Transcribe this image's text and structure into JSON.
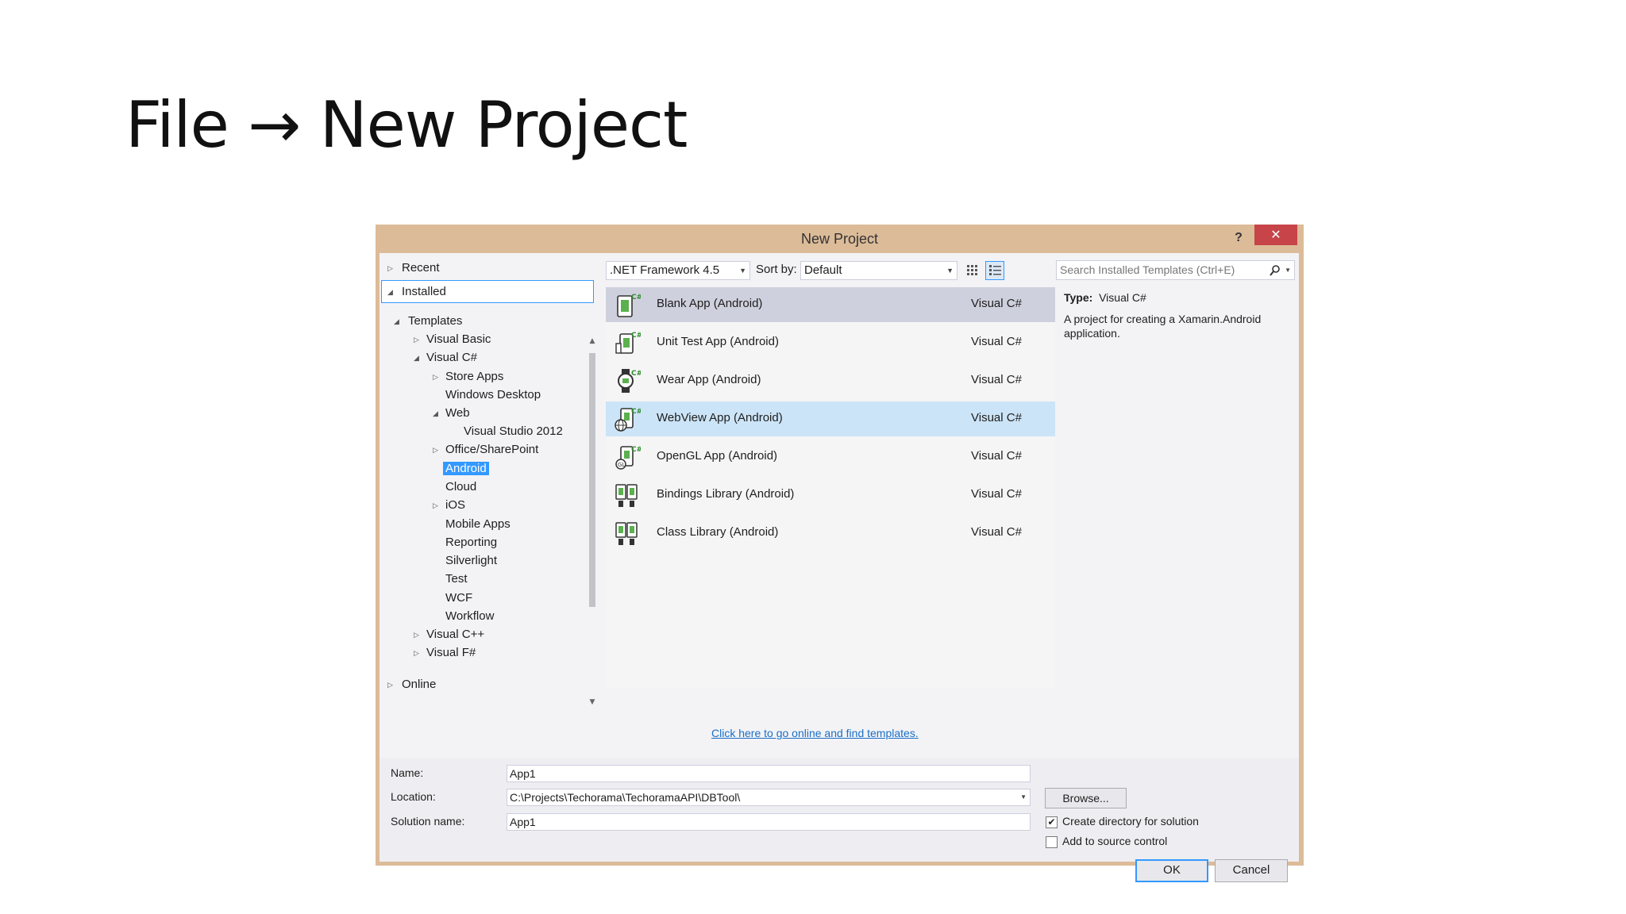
{
  "slide": {
    "title": "File → New Project"
  },
  "dialog": {
    "title": "New Project",
    "help": "?",
    "close": "✕"
  },
  "tree": {
    "recent": "Recent",
    "installed": "Installed",
    "templates": "Templates",
    "visual_basic": "Visual Basic",
    "visual_csharp": "Visual C#",
    "store_apps": "Store Apps",
    "windows_desktop": "Windows Desktop",
    "web": "Web",
    "vs2012": "Visual Studio 2012",
    "office": "Office/SharePoint",
    "android": "Android",
    "cloud": "Cloud",
    "ios": "iOS",
    "mobile_apps": "Mobile Apps",
    "reporting": "Reporting",
    "silverlight": "Silverlight",
    "test": "Test",
    "wcf": "WCF",
    "workflow": "Workflow",
    "visual_cpp": "Visual C++",
    "visual_fsharp": "Visual F#",
    "online": "Online"
  },
  "toolbar": {
    "framework": ".NET Framework 4.5",
    "sort_label": "Sort by:",
    "sort_value": "Default",
    "search_placeholder": "Search Installed Templates (Ctrl+E)"
  },
  "templates": [
    {
      "name": "Blank App (Android)",
      "lang": "Visual C#"
    },
    {
      "name": "Unit Test App (Android)",
      "lang": "Visual C#"
    },
    {
      "name": "Wear App (Android)",
      "lang": "Visual C#"
    },
    {
      "name": "WebView App (Android)",
      "lang": "Visual C#"
    },
    {
      "name": "OpenGL App (Android)",
      "lang": "Visual C#"
    },
    {
      "name": "Bindings Library (Android)",
      "lang": "Visual C#"
    },
    {
      "name": "Class Library (Android)",
      "lang": "Visual C#"
    }
  ],
  "details": {
    "type_label": "Type:",
    "type_value": "Visual C#",
    "description": "A project for creating a Xamarin.Android application."
  },
  "online_link": "Click here to go online and find templates.",
  "form": {
    "name_label": "Name:",
    "name_value": "App1",
    "location_label": "Location:",
    "location_value": "C:\\Projects\\Techorama\\TechoramaAPI\\DBTool\\",
    "solution_label": "Solution name:",
    "solution_value": "App1",
    "browse": "Browse...",
    "create_dir": "Create directory for solution",
    "create_dir_checked": true,
    "source_control": "Add to source control",
    "source_control_checked": false,
    "ok": "OK",
    "cancel": "Cancel"
  }
}
